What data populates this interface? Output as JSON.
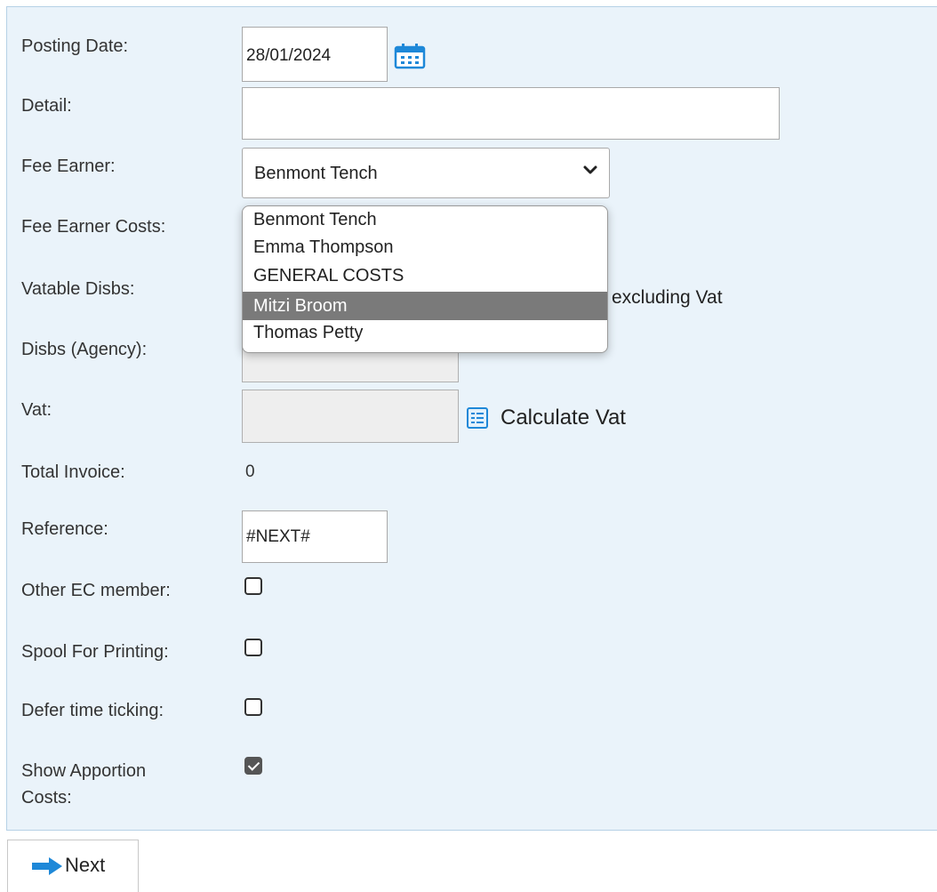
{
  "form": {
    "posting_date": {
      "label": "Posting Date:",
      "value": "28/01/2024"
    },
    "detail": {
      "label": "Detail:",
      "value": ""
    },
    "fee_earner": {
      "label": "Fee Earner:",
      "selected": "Benmont Tench",
      "options": [
        "Benmont Tench",
        "Emma Thompson",
        "GENERAL COSTS",
        "Mitzi Broom",
        "Thomas Petty"
      ],
      "highlighted": "Mitzi Broom"
    },
    "fee_earner_costs": {
      "label": "Fee Earner Costs:"
    },
    "vatable_disbs": {
      "label": "Vatable Disbs:",
      "note": "excluding Vat"
    },
    "disbs_agency": {
      "label": "Disbs (Agency):"
    },
    "vat": {
      "label": "Vat:",
      "value": "",
      "calculate_label": "Calculate Vat"
    },
    "total_invoice": {
      "label": "Total Invoice:",
      "value": "0"
    },
    "reference": {
      "label": "Reference:",
      "value": "#NEXT#"
    },
    "other_ec_member": {
      "label": "Other EC member:",
      "checked": false
    },
    "spool_for_printing": {
      "label": "Spool For Printing:",
      "checked": false
    },
    "defer_time_ticking": {
      "label": "Defer time ticking:",
      "checked": false
    },
    "show_apportion_costs": {
      "label_line1": "Show Apportion",
      "label_line2": "Costs:",
      "checked": true
    }
  },
  "actions": {
    "next_label": "Next"
  },
  "colors": {
    "panel_bg": "#eaf3fa",
    "panel_border": "#b6d1e6",
    "highlight": "#7a7a7a",
    "accent_icon": "#1e88d8"
  }
}
